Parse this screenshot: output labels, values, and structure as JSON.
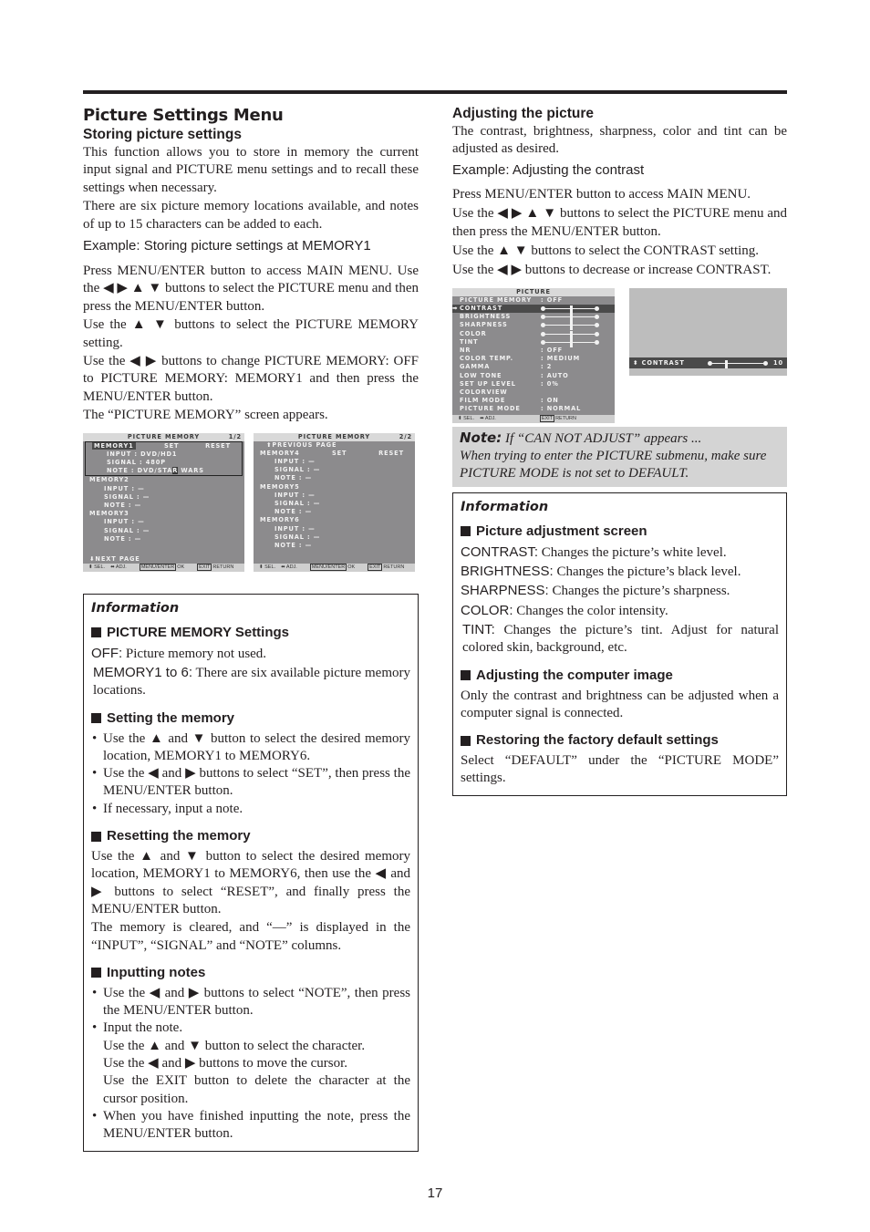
{
  "page": {
    "title": "Picture Settings Menu",
    "number": "17"
  },
  "left": {
    "heading": "Storing picture settings",
    "intro": [
      "This function allows you to store in memory the current input signal and PICTURE menu settings and to recall these settings when necessary.",
      "There are six picture memory locations available, and notes of up to 15 characters can be added to each."
    ],
    "example": "Example: Storing picture settings at MEMORY1",
    "steps": [
      "Press MENU/ENTER button to access MAIN MENU. Use the ◀ ▶ ▲ ▼ buttons to select the PICTURE menu and then press the MENU/ENTER button.",
      "Use the ▲ ▼ buttons to select the PICTURE MEMORY setting.",
      "Use the ◀ ▶ buttons to change PICTURE MEMORY: OFF to PICTURE MEMORY: MEMORY1 and then press the MENU/ENTER button.",
      "The “PICTURE MEMORY” screen appears."
    ],
    "osd_memory_p1": {
      "title": "PICTURE MEMORY",
      "page": "1/2",
      "set_label": "SET",
      "reset_label": "RESET",
      "memories": [
        {
          "name": "MEMORY1",
          "input": "INPUT : DVD/HD1",
          "signal": "SIGNAL : 480P",
          "note_prefix": "NOTE : DVD/STA",
          "note_cursor": "R",
          "note_suffix": " WARS"
        },
        {
          "name": "MEMORY2",
          "input": "INPUT : —",
          "signal": "SIGNAL : —",
          "note": "NOTE : —"
        },
        {
          "name": "MEMORY3",
          "input": "INPUT : —",
          "signal": "SIGNAL : —",
          "note": "NOTE : —"
        }
      ],
      "nav": "⬇NEXT PAGE",
      "footer": {
        "sel": "⬍ SEL.",
        "adj": "⬌ ADJ.",
        "ok_key": "MENU/ENTER",
        "ok": "OK",
        "exit_key": "EXIT",
        "return": "RETURN"
      }
    },
    "osd_memory_p2": {
      "title": "PICTURE MEMORY",
      "page": "2/2",
      "nav": "⬆PREVIOUS PAGE",
      "set_label": "SET",
      "reset_label": "RESET",
      "memories": [
        {
          "name": "MEMORY4",
          "input": "INPUT : —",
          "signal": "SIGNAL : —",
          "note": "NOTE : —"
        },
        {
          "name": "MEMORY5",
          "input": "INPUT : —",
          "signal": "SIGNAL : —",
          "note": "NOTE : —"
        },
        {
          "name": "MEMORY6",
          "input": "INPUT : —",
          "signal": "SIGNAL : —",
          "note": "NOTE : —"
        }
      ],
      "footer": {
        "sel": "⬍ SEL.",
        "adj": "⬌ ADJ.",
        "ok_key": "MENU/ENTER",
        "ok": "OK",
        "exit_key": "EXIT",
        "return": "RETURN"
      }
    },
    "info": {
      "title": "Information",
      "sections": {
        "pm_settings": {
          "heading": "PICTURE MEMORY Settings",
          "off_term": "OFF:",
          "off_text": " Picture memory not used.",
          "mem_term": "MEMORY1 to 6:",
          "mem_text": " There are six available picture memory locations."
        },
        "setting": {
          "heading": "Setting the memory",
          "bullets": [
            "Use the ▲ and ▼ button to select the desired memory location, MEMORY1 to MEMORY6.",
            "Use the ◀ and ▶ buttons to select “SET”, then press the MENU/ENTER button.",
            "If necessary, input a note."
          ]
        },
        "resetting": {
          "heading": "Resetting the memory",
          "paras": [
            "Use the ▲ and ▼ button to select the desired memory location, MEMORY1 to MEMORY6, then use the ◀ and ▶ buttons to select “RESET”, and finally press the MENU/ENTER button.",
            "The memory is cleared, and “—” is displayed in the “INPUT”, “SIGNAL” and “NOTE” columns."
          ]
        },
        "notes": {
          "heading": "Inputting notes",
          "b1": "Use the ◀ and ▶ buttons to select “NOTE”, then press the MENU/ENTER button.",
          "b2_lines": [
            "Input the note.",
            "Use the ▲ and ▼ button to select the character.",
            "Use the ◀ and ▶ buttons to move the cursor.",
            "Use the EXIT button to delete the character at the cursor position."
          ],
          "b3": "When you have finished inputting the note, press the MENU/ENTER button."
        }
      }
    }
  },
  "right": {
    "heading": "Adjusting the picture",
    "intro": "The contrast, brightness, sharpness, color and tint can be adjusted as desired.",
    "example": "Example: Adjusting the contrast",
    "steps": [
      "Press MENU/ENTER button to access MAIN MENU.",
      "Use the ◀ ▶ ▲ ▼ buttons to select the PICTURE menu and then press the MENU/ENTER button.",
      "Use the ▲ ▼ buttons to select the CONTRAST setting.",
      "Use the ◀ ▶ buttons to decrease or increase CONTRAST."
    ],
    "osd_picture": {
      "title": "PICTURE",
      "current_arrow": "➡",
      "rows": [
        {
          "label": "PICTURE MEMORY",
          "value": ":  OFF"
        },
        {
          "label": "CONTRAST",
          "slider": 0.5
        },
        {
          "label": "BRIGHTNESS",
          "slider": 0.5
        },
        {
          "label": "SHARPNESS",
          "slider": 0.5
        },
        {
          "label": "COLOR",
          "slider": 0.5
        },
        {
          "label": "TINT",
          "slider": 0.5
        },
        {
          "label": "NR",
          "value": ":  OFF"
        },
        {
          "label": "COLOR TEMP.",
          "value": ":  MEDIUM"
        },
        {
          "label": "GAMMA",
          "value": ":  2"
        },
        {
          "label": "LOW TONE",
          "value": ":  AUTO"
        },
        {
          "label": "SET UP LEVEL",
          "value": ":  0%"
        },
        {
          "label": "COLORVIEW",
          "value": ""
        },
        {
          "label": "FILM MODE",
          "value": ":  ON"
        },
        {
          "label": "PICTURE MODE",
          "value": ":  NORMAL"
        }
      ],
      "footer": {
        "sel": "⬍ SEL.",
        "adj": "⬌ ADJ.",
        "exit_key": "EXIT",
        "return": "RETURN"
      }
    },
    "osd_contrast": {
      "icon": "⬍",
      "label": "CONTRAST",
      "value": "10",
      "level": 0.25
    },
    "note": {
      "label": "Note:",
      "line1": " If “CAN NOT ADJUST” appears ...",
      "line2": "When trying to enter the PICTURE submenu, make sure PICTURE MODE is not set to DEFAULT."
    },
    "info": {
      "title": "Information",
      "adj_screen": {
        "heading": "Picture adjustment screen",
        "items": [
          {
            "term": "CONTRAST:",
            "text": " Changes the picture’s white level."
          },
          {
            "term": "BRIGHTNESS:",
            "text": " Changes the picture’s black level."
          },
          {
            "term": "SHARPNESS:",
            "text": " Changes the picture’s sharpness."
          },
          {
            "term": "COLOR:",
            "text": " Changes the color intensity."
          },
          {
            "term": "TINT:",
            "text": " Changes the picture’s tint. Adjust for natural colored skin, background, etc."
          }
        ]
      },
      "computer": {
        "heading": "Adjusting the computer image",
        "text": "Only the contrast and brightness can be adjusted when a computer signal is connected."
      },
      "restore": {
        "heading": "Restoring the factory default settings",
        "text": "Select “DEFAULT” under the “PICTURE MODE” settings."
      }
    }
  }
}
